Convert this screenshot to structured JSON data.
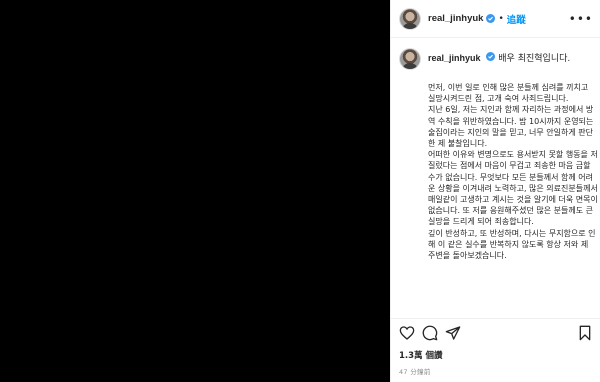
{
  "post": {
    "username": "real_jinhyuk",
    "follow_label": "追蹤",
    "separator": "•",
    "caption_intro": "배우 최진혁입니다.",
    "caption_paragraphs": [
      "먼저, 이번 일로 인해 많은 분들께 심려를 끼치고 실망시켜드린 점, 고개 숙여 사죄드립니다.",
      "지난 6일, 저는 지인과 함께 자리하는 과정에서 방역 수칙을 위반하였습니다. 밤 10시까지 운영되는 술집이라는 지인의 말을 믿고, 너무 안일하게 판단한 제 불찰입니다.",
      "어떠한 이유와 변명으로도 용서받지 못할 행동을 저질렀다는 점에서 마음이 무겁고 죄송한 마음 금할 수가 없습니다. 무엇보다 모든 분들께서 함께 어려운 상황을 이겨내려 노력하고, 많은 의료진분들께서 매일같이 고생하고 계시는 것을 알기에 더욱 면목이 없습니다. 또 저를 응원해주셨던 많은 분들께도 큰 실망을 드리게 되어 죄송합니다.",
      "깊이 반성하고, 또 반성하며, 다시는 무지함으로 인해 이 같은 실수를 반복하지 않도록 항상 저와 제 주변을 돌아보겠습니다."
    ],
    "likes": "1.3萬 個讚",
    "timestamp": "47 分鐘前"
  },
  "icons": {
    "verified": "verified-badge-icon",
    "more": "more-options-icon",
    "like": "heart-icon",
    "comment": "comment-icon",
    "share": "send-icon",
    "save": "bookmark-icon"
  },
  "colors": {
    "accent": "#0095f6",
    "media_bg": "#000000",
    "muted": "#8e8e8e"
  }
}
